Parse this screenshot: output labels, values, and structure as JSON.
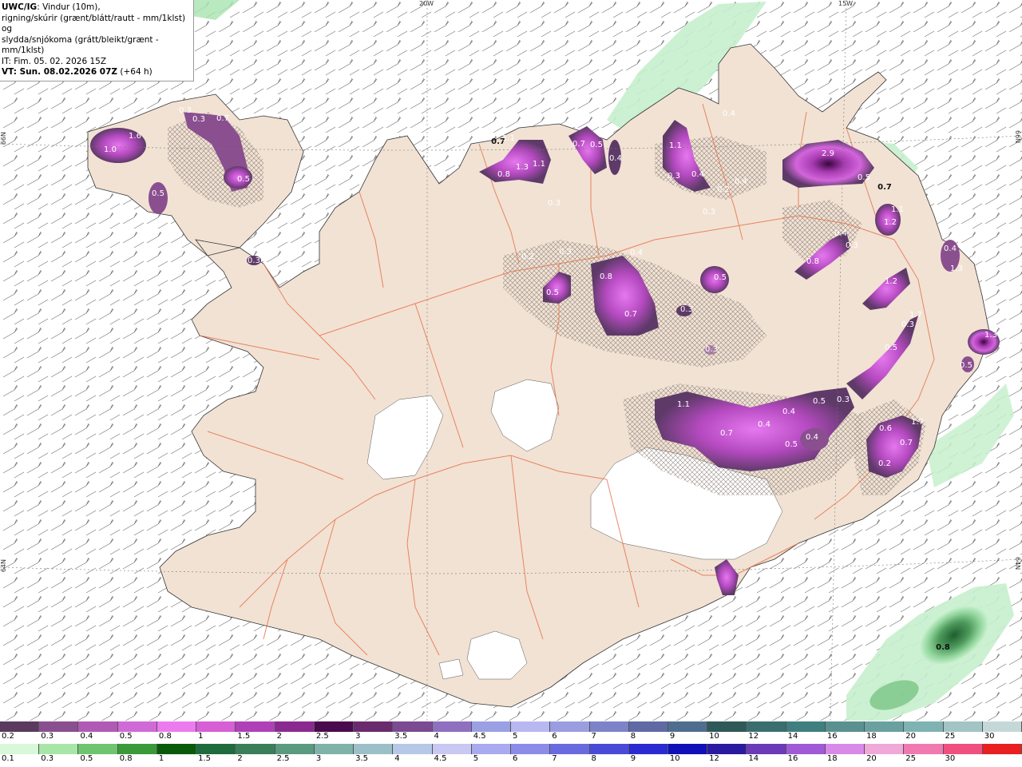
{
  "header": {
    "title_bold": "UWC/IG",
    "title_rest": ": Vindur (10m),",
    "line2": "rigning/skúrir (grænt/blátt/rautt - mm/1klst) og",
    "line3": "slydda/snjókoma (grátt/bleikt/grænt - mm/1klst)",
    "it_line": "IT: Fim. 05. 02. 2026 15Z",
    "vt_bold": "VT: Sun. 08.02.2026 07Z",
    "vt_rest": " (+64 h)"
  },
  "coords": {
    "lon_20w": "20W",
    "lon_15w": "15W",
    "lat_66n_left": "66N",
    "lat_66n_right": "66N",
    "lat_64n_left": "64N",
    "lat_64n_right": "64N"
  },
  "map_labels": [
    {
      "text": "0.2",
      "dark": false
    },
    {
      "text": "0.2",
      "dark": false
    },
    {
      "text": "1.0",
      "dark": false
    },
    {
      "text": "1.6",
      "dark": false
    },
    {
      "text": "0.3",
      "dark": false
    },
    {
      "text": "0.3",
      "dark": false
    },
    {
      "text": "0.7",
      "dark": false
    },
    {
      "text": "0.5",
      "dark": false
    },
    {
      "text": "0.5",
      "dark": false
    },
    {
      "text": "0.3",
      "dark": false
    },
    {
      "text": "0.7",
      "dark": true
    },
    {
      "text": "1.1",
      "dark": false
    },
    {
      "text": "0.8",
      "dark": false
    },
    {
      "text": "1.3",
      "dark": false
    },
    {
      "text": "1.1",
      "dark": false
    },
    {
      "text": "0.7",
      "dark": false
    },
    {
      "text": "0.5",
      "dark": false
    },
    {
      "text": "0.4",
      "dark": false
    },
    {
      "text": "1.1",
      "dark": false
    },
    {
      "text": "0.3",
      "dark": false
    },
    {
      "text": "0.4",
      "dark": false
    },
    {
      "text": "0.2",
      "dark": false
    },
    {
      "text": "0.4",
      "dark": false
    },
    {
      "text": "0.4",
      "dark": false
    },
    {
      "text": "2.9",
      "dark": false
    },
    {
      "text": "0.5",
      "dark": false
    },
    {
      "text": "0.7",
      "dark": true
    },
    {
      "text": "0.3",
      "dark": false
    },
    {
      "text": "0.3",
      "dark": false
    },
    {
      "text": "1.1",
      "dark": false
    },
    {
      "text": "1.2",
      "dark": false
    },
    {
      "text": "0.4",
      "dark": false
    },
    {
      "text": "0.8",
      "dark": false
    },
    {
      "text": "0.3",
      "dark": false
    },
    {
      "text": "0.2",
      "dark": false
    },
    {
      "text": "0.3",
      "dark": false
    },
    {
      "text": "0.4",
      "dark": false
    },
    {
      "text": "0.4",
      "dark": false
    },
    {
      "text": "0.8",
      "dark": false
    },
    {
      "text": "0.5",
      "dark": false
    },
    {
      "text": "0.5",
      "dark": false
    },
    {
      "text": "0.7",
      "dark": false
    },
    {
      "text": "0.3",
      "dark": false
    },
    {
      "text": "1.2",
      "dark": false
    },
    {
      "text": "0.3",
      "dark": false
    },
    {
      "text": "0.3",
      "dark": false
    },
    {
      "text": "1.7",
      "dark": false
    },
    {
      "text": "0.5",
      "dark": false
    },
    {
      "text": "1.1",
      "dark": false
    },
    {
      "text": "0.7",
      "dark": false
    },
    {
      "text": "0.4",
      "dark": false
    },
    {
      "text": "0.4",
      "dark": false
    },
    {
      "text": "0.5",
      "dark": false
    },
    {
      "text": "0.4",
      "dark": false
    },
    {
      "text": "0.5",
      "dark": false
    },
    {
      "text": "0.3",
      "dark": false
    },
    {
      "text": "0.6",
      "dark": false
    },
    {
      "text": "0.7",
      "dark": false
    },
    {
      "text": "1.7",
      "dark": false
    },
    {
      "text": "0.2",
      "dark": false
    },
    {
      "text": "0.5",
      "dark": false
    },
    {
      "text": "1.3",
      "dark": false
    },
    {
      "text": "1.3",
      "dark": false
    },
    {
      "text": "0.8",
      "dark": true
    }
  ],
  "legend_snow": {
    "colors": [
      "#5b3a5f",
      "#8a4f8f",
      "#b05ab6",
      "#cf6ad6",
      "#ec7bf0",
      "#d65fd6",
      "#b040b8",
      "#8a2a90",
      "#4a0a4e",
      "#6a2a6e",
      "#7b4a93",
      "#8f6fbf",
      "#9aa0e3",
      "#b7b8f2",
      "#9a9de0",
      "#7d83c9",
      "#5f6aa5",
      "#4f6e8f",
      "#2f5858",
      "#3b6e6e",
      "#3f7f7f",
      "#5a9090",
      "#6aa0a0",
      "#7fb2b2",
      "#a2c4c4",
      "#c4d8d8"
    ],
    "labels": [
      "0.2",
      "0.3",
      "0.4",
      "0.5",
      "0.8",
      "1",
      "1.5",
      "2",
      "2.5",
      "3",
      "3.5",
      "4",
      "4.5",
      "5",
      "6",
      "7",
      "8",
      "9",
      "10",
      "12",
      "14",
      "16",
      "18",
      "20",
      "25",
      "30"
    ]
  },
  "legend_rain": {
    "colors": [
      "#d9f7d9",
      "#a8e6a8",
      "#6fc46f",
      "#3a9a3a",
      "#0a5a0a",
      "#1e6b3e",
      "#3a7f5a",
      "#5a9a7f",
      "#7fb2a8",
      "#9cc0c8",
      "#b6c8e8",
      "#c8c8f2",
      "#aaaaf0",
      "#8c8ce8",
      "#6a6ae0",
      "#4a4ad8",
      "#2a2ad0",
      "#1010b8",
      "#2a1aa0",
      "#6a3ab8",
      "#a05ad8",
      "#d88ae8",
      "#f0a8d8",
      "#f07ab0",
      "#f0507f",
      "#e82020"
    ],
    "labels": [
      "0.1",
      "0.3",
      "0.5",
      "0.8",
      "1",
      "1.5",
      "2",
      "2.5",
      "3",
      "3.5",
      "4",
      "4.5",
      "5",
      "6",
      "7",
      "8",
      "9",
      "10",
      "12",
      "14",
      "16",
      "18",
      "20",
      "25",
      "30"
    ]
  },
  "colors": {
    "land": "#f1e2d4",
    "ocean": "#ffffff",
    "roads": "#e8734a",
    "glacier": "#ffffff",
    "green_rain": "#b8eec0"
  }
}
